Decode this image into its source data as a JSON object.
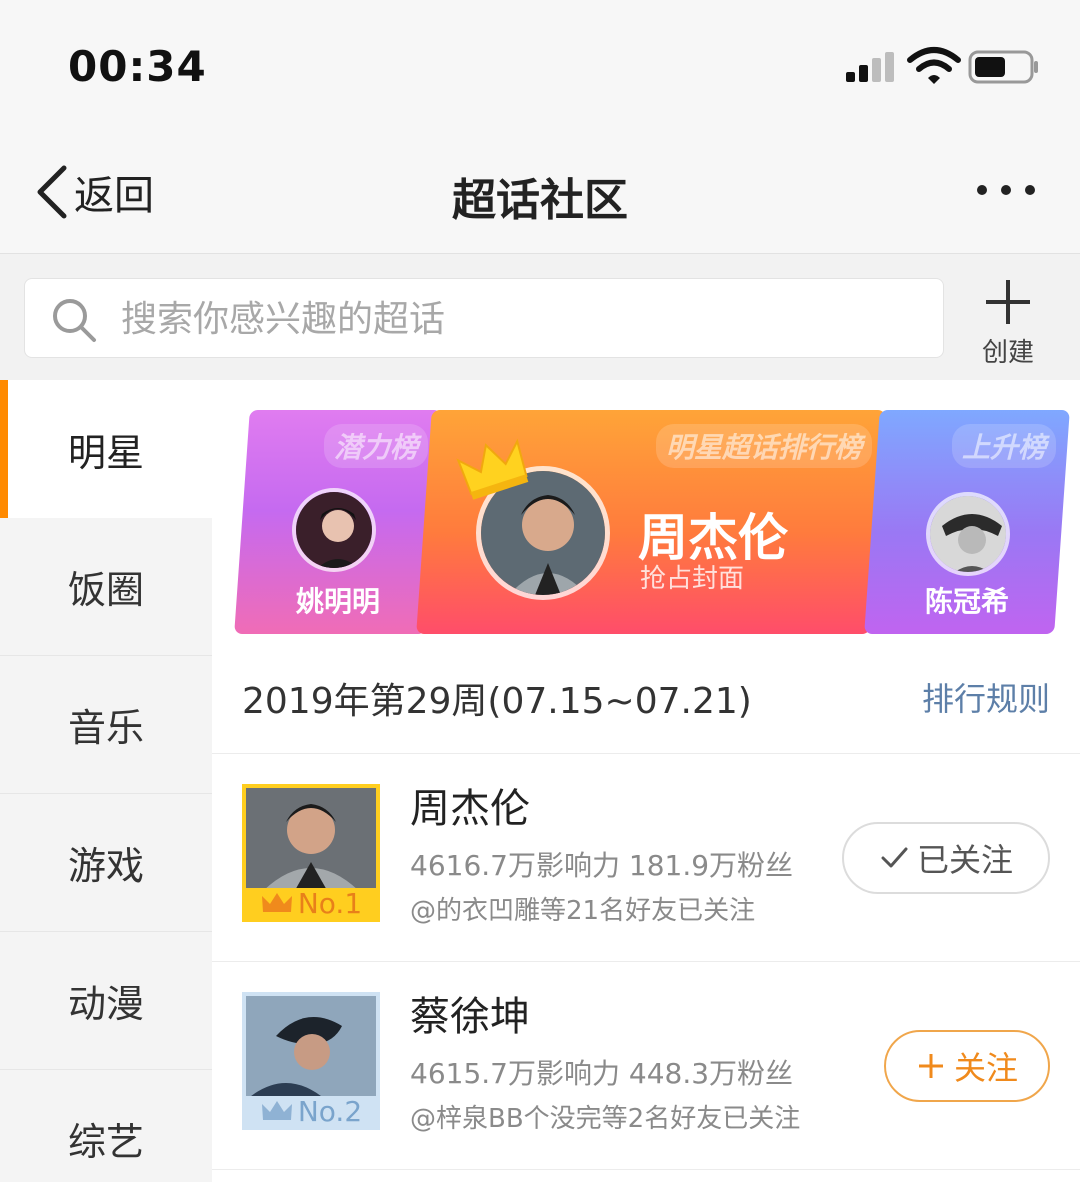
{
  "status_bar": {
    "time": "00:34"
  },
  "nav": {
    "back_label": "返回",
    "title": "超话社区"
  },
  "search": {
    "placeholder": "搜索你感兴趣的超话",
    "create_label": "创建"
  },
  "sidebar": {
    "items": [
      {
        "label": "明星",
        "active": true
      },
      {
        "label": "饭圈"
      },
      {
        "label": "音乐"
      },
      {
        "label": "游戏"
      },
      {
        "label": "动漫"
      },
      {
        "label": "综艺"
      }
    ]
  },
  "banners": {
    "left": {
      "tag": "潜力榜",
      "name": "姚明明"
    },
    "middle": {
      "tag": "明星超话排行榜",
      "name": "周杰伦",
      "sub": "抢占封面"
    },
    "right": {
      "tag": "上升榜",
      "name": "陈冠希"
    }
  },
  "week": {
    "text": "2019年第29周(07.15~07.21)",
    "rules_link": "排行规则"
  },
  "ranking": [
    {
      "badge": "No.1",
      "name": "周杰伦",
      "stats": "4616.7万影响力  181.9万粉丝",
      "friends": "@的衣凹雕等21名好友已关注",
      "button": "已关注",
      "followed": true
    },
    {
      "badge": "No.2",
      "name": "蔡徐坤",
      "stats": "4615.7万影响力  448.3万粉丝",
      "friends": "@梓泉BB个没完等2名好友已关注",
      "button": "关注",
      "followed": false
    }
  ],
  "colors": {
    "accent": "#ff8a00",
    "link": "#5d7fa8",
    "follow": "#f08a1c",
    "gold": "#ffce1f",
    "silver": "#cfe2f3"
  }
}
